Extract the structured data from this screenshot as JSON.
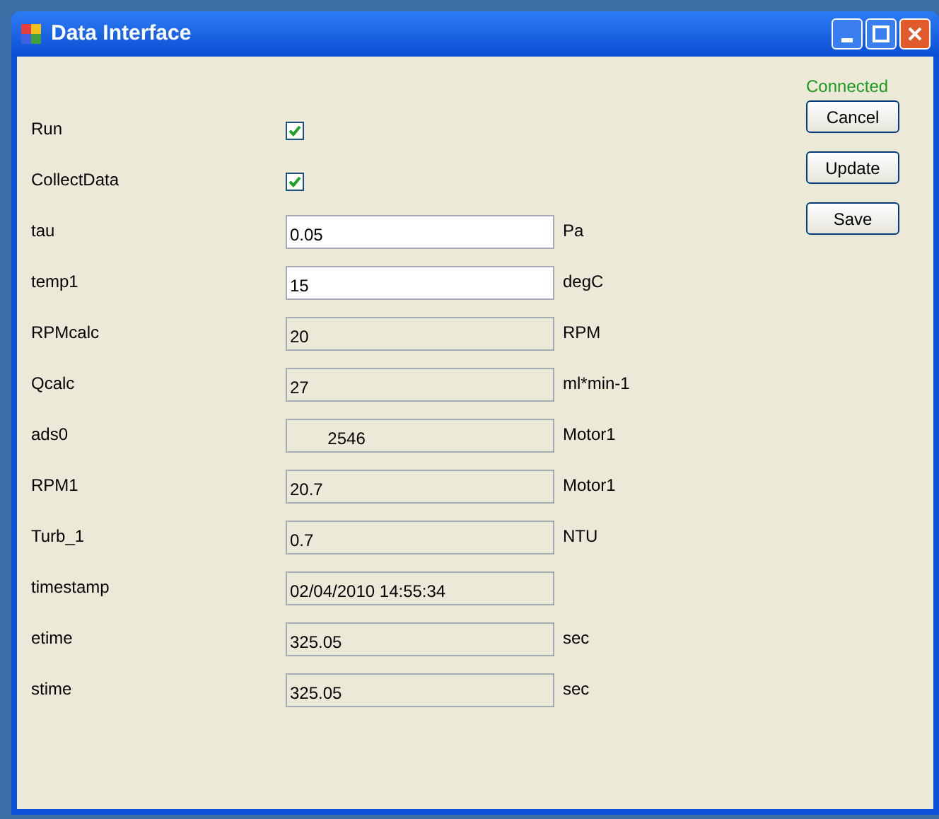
{
  "window": {
    "title": "Data Interface"
  },
  "status": {
    "text": "Connected"
  },
  "buttons": [
    "Cancel",
    "Update",
    "Save"
  ],
  "rows": [
    {
      "kind": "checkbox",
      "label": "Run",
      "checked": true
    },
    {
      "kind": "checkbox",
      "label": "CollectData",
      "checked": true
    },
    {
      "kind": "field",
      "label": "tau",
      "value": "0.05",
      "read_only": false,
      "unit": "Pa"
    },
    {
      "kind": "field",
      "label": "temp1",
      "value": "15",
      "read_only": false,
      "unit": "degC"
    },
    {
      "kind": "field",
      "label": "RPMcalc",
      "value": "20",
      "read_only": true,
      "unit": "RPM"
    },
    {
      "kind": "field",
      "label": "Qcalc",
      "value": "27",
      "read_only": true,
      "unit": "ml*min-1"
    },
    {
      "kind": "field",
      "label": "ads0",
      "value": "        2546",
      "read_only": true,
      "unit": "Motor1"
    },
    {
      "kind": "field",
      "label": "RPM1",
      "value": "20.7",
      "read_only": true,
      "unit": "Motor1"
    },
    {
      "kind": "field",
      "label": "Turb_1",
      "value": "0.7",
      "read_only": true,
      "unit": "NTU"
    },
    {
      "kind": "field",
      "label": "timestamp",
      "value": "02/04/2010 14:55:34",
      "read_only": true
    },
    {
      "kind": "field",
      "label": "etime",
      "value": "325.05",
      "read_only": true,
      "unit": "sec"
    },
    {
      "kind": "field",
      "label": "stime",
      "value": "325.05",
      "read_only": true,
      "unit": "sec"
    }
  ]
}
